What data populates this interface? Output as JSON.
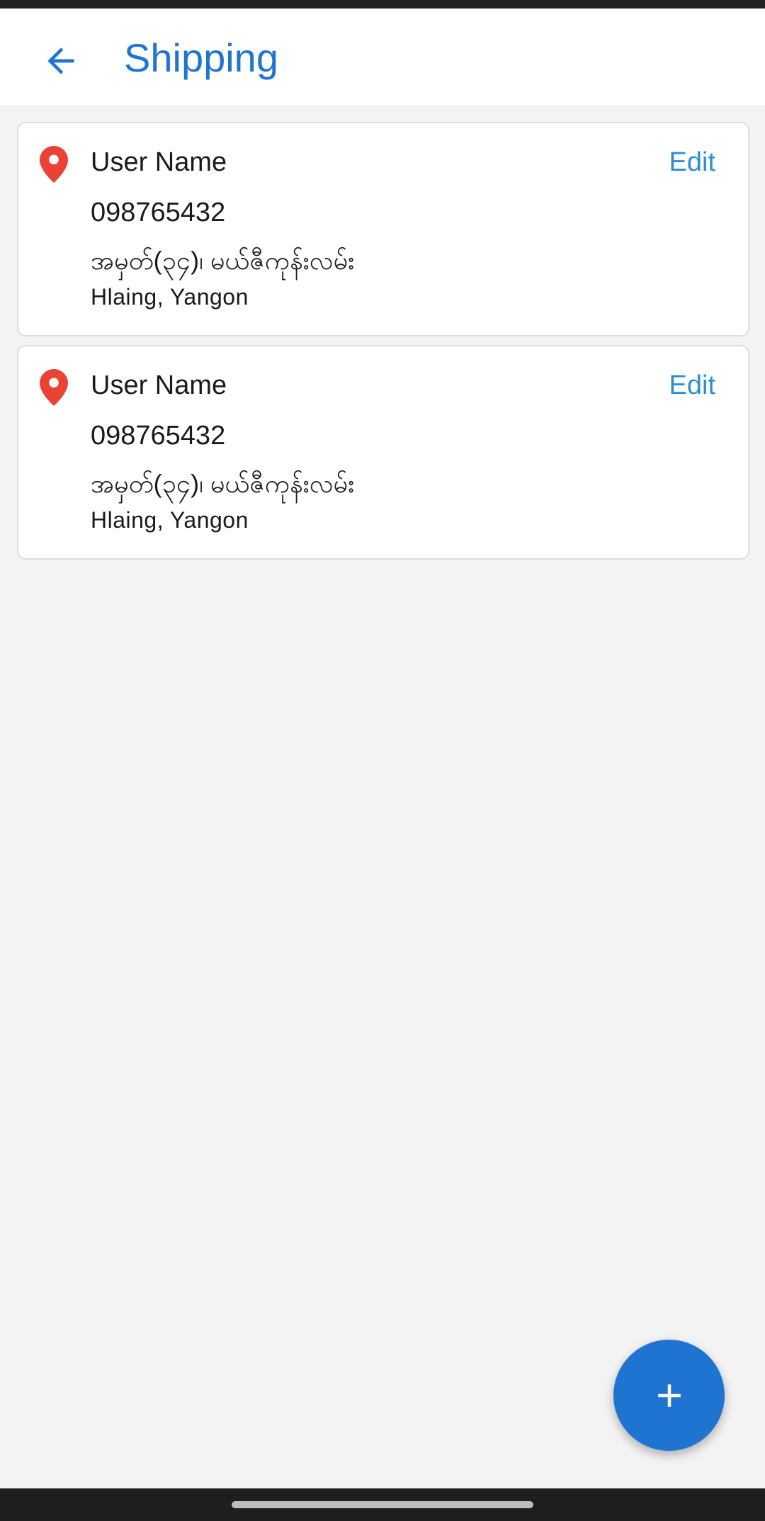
{
  "header": {
    "title": "Shipping",
    "back_icon": "arrow-left-icon",
    "accent_color": "#1f74d1"
  },
  "addresses": [
    {
      "name": "User Name",
      "phone": "098765432",
      "street": "အမှတ်(၃၄)၊ မယ်ဇီကုန်းလမ်း",
      "city": "Hlaing, Yangon",
      "edit_label": "Edit",
      "pin_icon": "location-pin-icon",
      "pin_color": "#ea4335"
    },
    {
      "name": "User Name",
      "phone": "098765432",
      "street": "အမှတ်(၃၄)၊ မယ်ဇီကုန်းလမ်း",
      "city": "Hlaing, Yangon",
      "edit_label": "Edit",
      "pin_icon": "location-pin-icon",
      "pin_color": "#ea4335"
    }
  ],
  "fab": {
    "icon": "plus-icon"
  }
}
